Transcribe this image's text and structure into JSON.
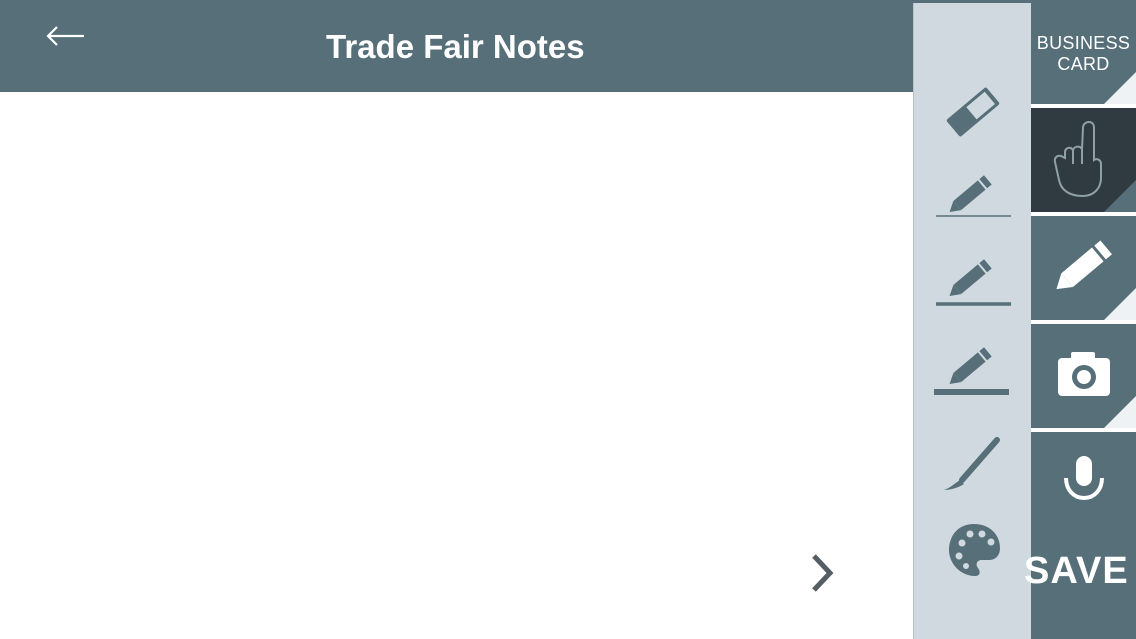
{
  "header": {
    "title": "Trade Fair Notes",
    "back_icon": "arrow-left-icon"
  },
  "canvas": {
    "next_icon": "chevron-right-icon"
  },
  "tools": [
    {
      "name": "eraser",
      "icon": "eraser-icon"
    },
    {
      "name": "pen-thin",
      "icon": "pencil-icon"
    },
    {
      "name": "pen-medium",
      "icon": "pencil-icon"
    },
    {
      "name": "pen-thick",
      "icon": "pencil-icon"
    },
    {
      "name": "brush",
      "icon": "brush-icon"
    },
    {
      "name": "palette",
      "icon": "palette-icon"
    }
  ],
  "tabs": {
    "business_card_line1": "BUSINESS",
    "business_card_line2": "CARD",
    "finger_icon": "finger-pointer-icon",
    "pencil_icon": "pencil-icon",
    "camera_icon": "camera-icon",
    "mic_icon": "microphone-icon",
    "save_label": "SAVE"
  },
  "colors": {
    "header": "#566f79",
    "tool_panel": "#d0d9df",
    "tab": "#566f79",
    "tab_active": "#2f3b40",
    "icon": "#566f79",
    "white": "#ffffff"
  }
}
